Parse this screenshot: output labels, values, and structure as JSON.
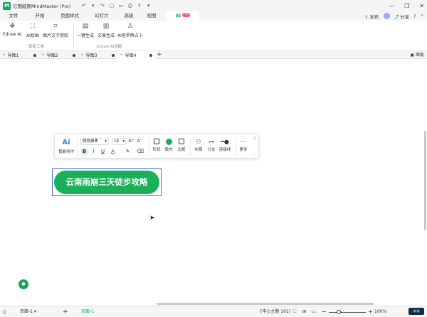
{
  "titlebar": {
    "logo_glyph": "M",
    "title": "亿图脑图MindMaster (Pro)",
    "quick_icons": [
      "undo-icon",
      "redo-icon",
      "save-icon",
      "open-folder-icon",
      "print-icon",
      "export-icon",
      "more-icon"
    ]
  },
  "menubar": {
    "items": [
      "文件",
      "开始",
      "页面样式",
      "幻灯片",
      "高级",
      "视图",
      "AI"
    ],
    "ai_badge": "Pro",
    "publish": "发布",
    "share": "分享"
  },
  "ribbon": {
    "buttons": [
      "Edraw AI",
      "AI绘画",
      "图片文字提取",
      "一键生成",
      "文章生成",
      "AI塔罗牌占卜"
    ],
    "group1_label": "智能工具",
    "group2_label": "Edraw AI功能"
  },
  "tabs": {
    "items": [
      "导图1",
      "导图2",
      "导图3",
      "导图4"
    ],
    "active_index": 3,
    "panel": "面板"
  },
  "floatbar": {
    "ai_glyph": "Ai",
    "ai_label": "智能创作",
    "font": "微软雅黑",
    "size": "18",
    "grow_font": "A⁺",
    "shrink_font": "A⁻",
    "bold": "B",
    "italic": "I",
    "underline": "U",
    "font_color": "A",
    "shape": "形状",
    "fill": "填充",
    "border": "边框",
    "layout": "布局",
    "branch": "分支",
    "connector": "连接线",
    "more": "更多",
    "accent_color": "#1ab05a"
  },
  "node": {
    "text": "云南雨崩三天徒步攻略",
    "color": "#1ab05a"
  },
  "statusbar": {
    "page_select": "页面-1",
    "page_tab": "页面-1",
    "center_topic": "[中心主题 101]",
    "zoom": "100%"
  }
}
